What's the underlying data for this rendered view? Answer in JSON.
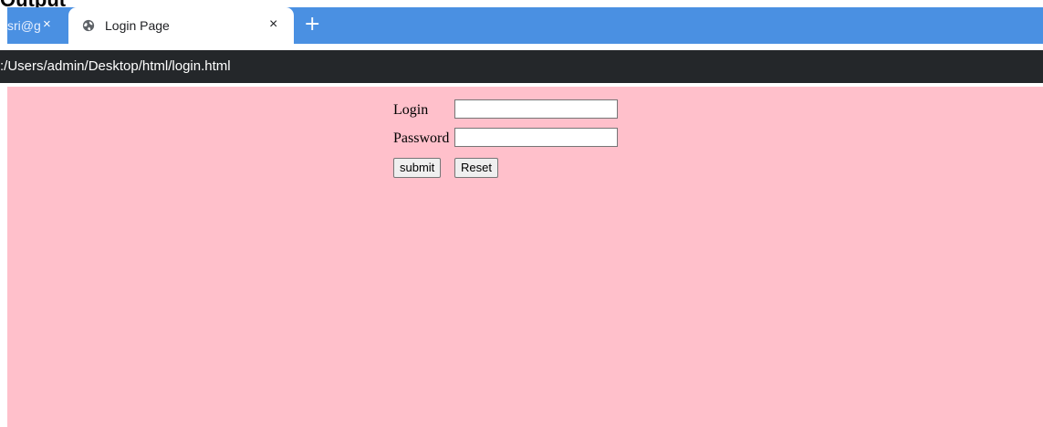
{
  "heading_fragment": "Output",
  "browser": {
    "tabs": [
      {
        "title": "sri@g",
        "active": false
      },
      {
        "title": "Login Page",
        "active": true
      }
    ],
    "close_glyph": "×",
    "new_tab_glyph": "+",
    "address": ":/Users/admin/Desktop/html/login.html"
  },
  "page": {
    "background_color": "#ffc0cb",
    "form": {
      "login_label": "Login",
      "login_value": "",
      "password_label": "Password",
      "password_value": "",
      "submit_label": "submit",
      "reset_label": "Reset"
    }
  },
  "colors": {
    "tab_strip": "#4a90e2",
    "address_bar": "#24272a"
  },
  "icons": {
    "active_tab_icon": "globe-icon",
    "close_icon": "close-icon",
    "new_tab_icon": "plus-icon"
  }
}
